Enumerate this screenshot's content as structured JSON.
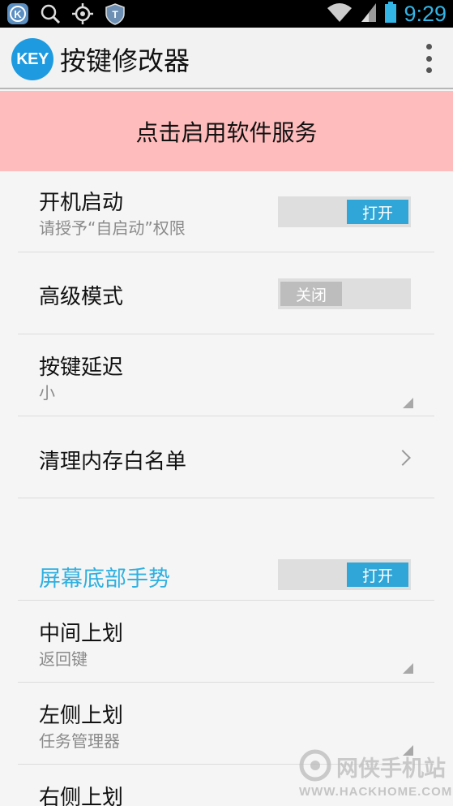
{
  "status_bar": {
    "time": "9:29",
    "icons": [
      "k-app-icon",
      "search-icon",
      "gps-icon",
      "shield-icon",
      "wifi-icon",
      "signal-icon",
      "battery-icon"
    ]
  },
  "action_bar": {
    "logo_text": "KEY",
    "title": "按键修改器",
    "overflow_icon": "overflow-menu-icon"
  },
  "banner": {
    "text": "点击启用软件服务",
    "color": "#ffbcbc"
  },
  "settings": {
    "boot_start": {
      "title": "开机启动",
      "subtitle": "请授予“自启动”权限",
      "toggle": "打开",
      "state": "on"
    },
    "advanced_mode": {
      "title": "高级模式",
      "toggle": "关闭",
      "state": "off"
    },
    "key_delay": {
      "title": "按键延迟",
      "subtitle": "小"
    },
    "whitelist": {
      "title": "清理内存白名单"
    }
  },
  "gestures": {
    "section_title": "屏幕底部手势",
    "toggle": "打开",
    "state": "on",
    "accent_color": "#2fb0e0",
    "middle_swipe": {
      "title": "中间上划",
      "subtitle": "返回键"
    },
    "left_swipe": {
      "title": "左侧上划",
      "subtitle": "任务管理器"
    },
    "right_swipe": {
      "title": "右侧上划"
    }
  },
  "watermark": {
    "name": "网侠手机站",
    "url": "WWW.HACKHOME.COM"
  }
}
